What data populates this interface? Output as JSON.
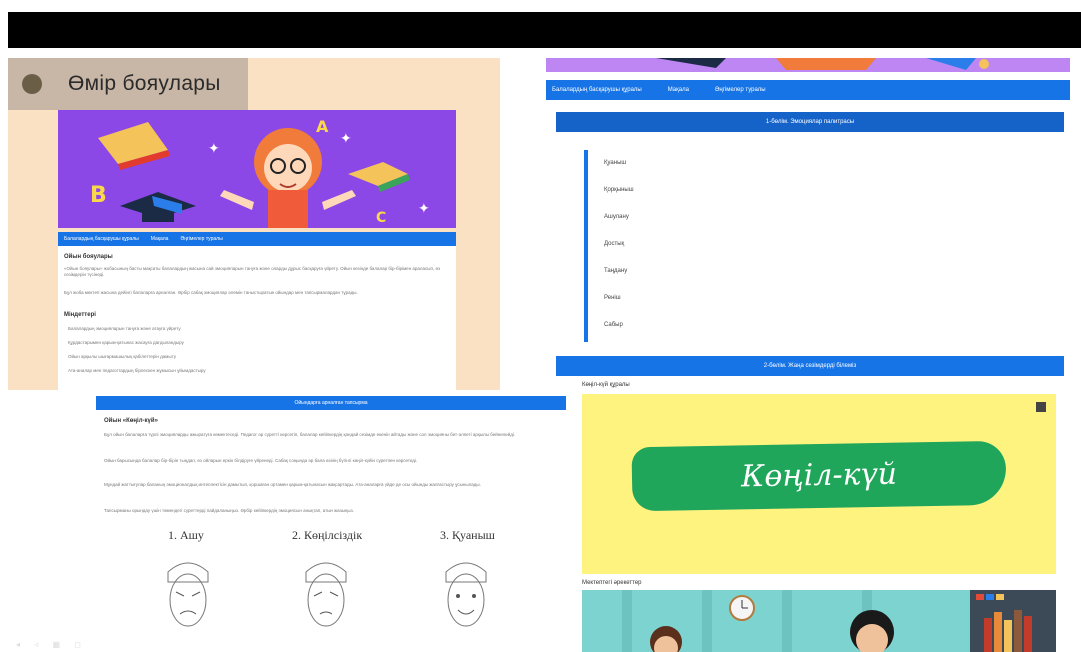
{
  "site": {
    "title": "Өмір бояулары",
    "nav": [
      "Балалардың басқарушы құралы",
      "Мақала",
      "Әңгімелер туралы"
    ],
    "body_heading": "Ойын бояулары",
    "body_text_1": "«Ойын бояулары» жобасының басты мақсаты балалардың жасына сай эмоцияларын тануға және оларды дұрыс басқаруға үйрету. Ойын кезінде балалар бір-бірімен араласып, өз сезімдерін түсінеді.",
    "body_text_2": "Бұл жоба мектеп жасына дейінгі балаларға арналған. Әрбір сабақ эмоциялар әлемін таныстыратын ойындар мен тапсырмалардан тұрады.",
    "goals_heading": "Міндеттері",
    "goals": [
      "Балалардың эмоцияларын тануға және атауға үйрету",
      "Құрдастарымен қарым-қатынас жасауға дағдыландыру",
      "Ойын арқылы шығармашылық қабілеттерін дамыту",
      "Ата-аналар мен педагогтардың бірлескен жұмысын ұйымдастыру"
    ]
  },
  "right_panel": {
    "nav": [
      "Балалардың басқарушы құралы",
      "Мақала",
      "Әңгімелер туралы"
    ],
    "section1_title": "1-бөлім. Эмоциялар палитрасы",
    "emotions": [
      "Қуаныш",
      "Қорқыныш",
      "Ашулану",
      "Достық",
      "Таңдану",
      "Реніш",
      "Сабыр"
    ],
    "section2_title": "2-бөлім. Жаңа сезімдерді білеміз",
    "image1_caption": "Көңіл-күй құралы",
    "image1_text": "Көңіл-күй",
    "image2_caption": "Мектептегі әрекеттер"
  },
  "bottom_panel": {
    "bar_title": "Ойындарға арналған тапсырма",
    "heading": "Ойын «Көңіл-күй»",
    "paragraphs": [
      "Бұл ойын балаларға түрлі эмоцияларды ажыратуға көмектеседі. Педагог әр суретті көрсетіп, балалар кейіпкердің қандай сезімде екенін айтады және сол эмоцияны бет-әлпеті арқылы бейнелейді.",
      "Ойын барысында балалар бір-бірін тыңдап, өз ойларын еркін білдіруге үйренеді. Сабақ соңында әр бала өзінің бүгінгі көңіл-күйін суретпен көрсетеді.",
      "Мұндай жаттығулар баланың эмоционалдық интеллектісін дамытып, қоршаған ортамен қарым-қатынасын жақсартады. Ата-аналарға үйде де осы ойынды жалғастыру ұсынылады.",
      "Тапсырманы орындау үшін төмендегі суреттерді пайдаланыңыз. Әрбір кейіпкердің эмоциясын анықтап, атын жазыңыз."
    ],
    "faces": [
      "1. Ашу",
      "2. Көңілсіздік",
      "3. Қуаныш"
    ]
  },
  "colors": {
    "accent_blue": "#1774e6",
    "peach": "#fbe1c3",
    "hero_purple": "#8c47e7",
    "yellow": "#fff380",
    "green": "#1fa65a"
  }
}
